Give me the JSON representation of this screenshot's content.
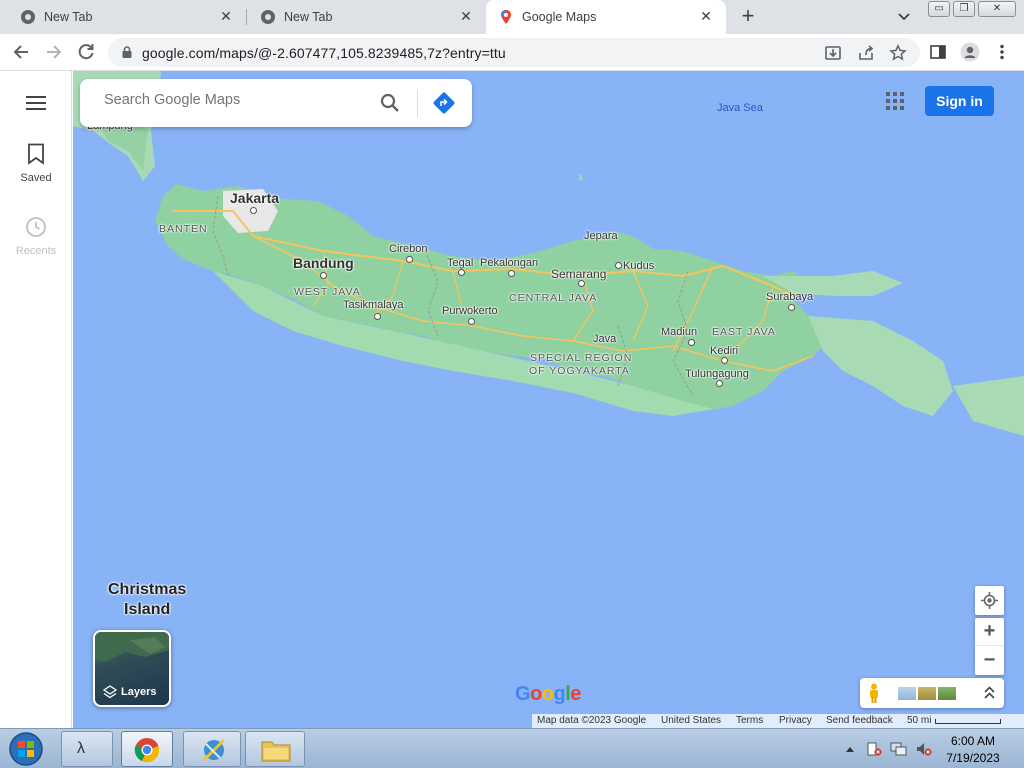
{
  "browser": {
    "tabs": [
      {
        "title": "New Tab"
      },
      {
        "title": "New Tab"
      },
      {
        "title": "Google Maps"
      }
    ],
    "url": "google.com/maps/@-2.607477,105.8239485,7z?entry=ttu"
  },
  "maps": {
    "search_placeholder": "Search Google Maps",
    "sign_in_label": "Sign in",
    "rail": [
      {
        "label": "Saved",
        "icon": "bookmark-icon"
      },
      {
        "label": "Recents",
        "icon": "history-icon"
      }
    ],
    "layers_label": "Layers",
    "logo_text": "Google",
    "map_labels": {
      "java_sea": "Java Sea",
      "lampung": "Lampung",
      "jakarta": "Jakarta",
      "banten": "BANTEN",
      "cirebon": "Cirebon",
      "jepara": "Jepara",
      "bandung": "Bandung",
      "tegal": "Tegal",
      "pekalongan": "Pekalongan",
      "semarang": "Semarang",
      "kudus": "Kudus",
      "west_java": "WEST JAVA",
      "central_java": "CENTRAL JAVA",
      "surabaya": "Surabaya",
      "tasikmalaya": "Tasikmalaya",
      "purwokerto": "Purwokerto",
      "madiun": "Madiun",
      "east_java": "EAST JAVA",
      "java": "Java",
      "kediri": "Kediri",
      "special_region_1": "SPECIAL REGION",
      "special_region_2": "OF YOGYAKARTA",
      "tulungagung": "Tulungagung",
      "christmas_1": "Christmas",
      "christmas_2": "Island"
    },
    "footer": {
      "map_data": "Map data ©2023 Google",
      "country": "United States",
      "terms": "Terms",
      "privacy": "Privacy",
      "feedback": "Send feedback",
      "scale": "50 mi"
    }
  },
  "taskbar": {
    "time": "6:00 AM",
    "date": "7/19/2023"
  }
}
